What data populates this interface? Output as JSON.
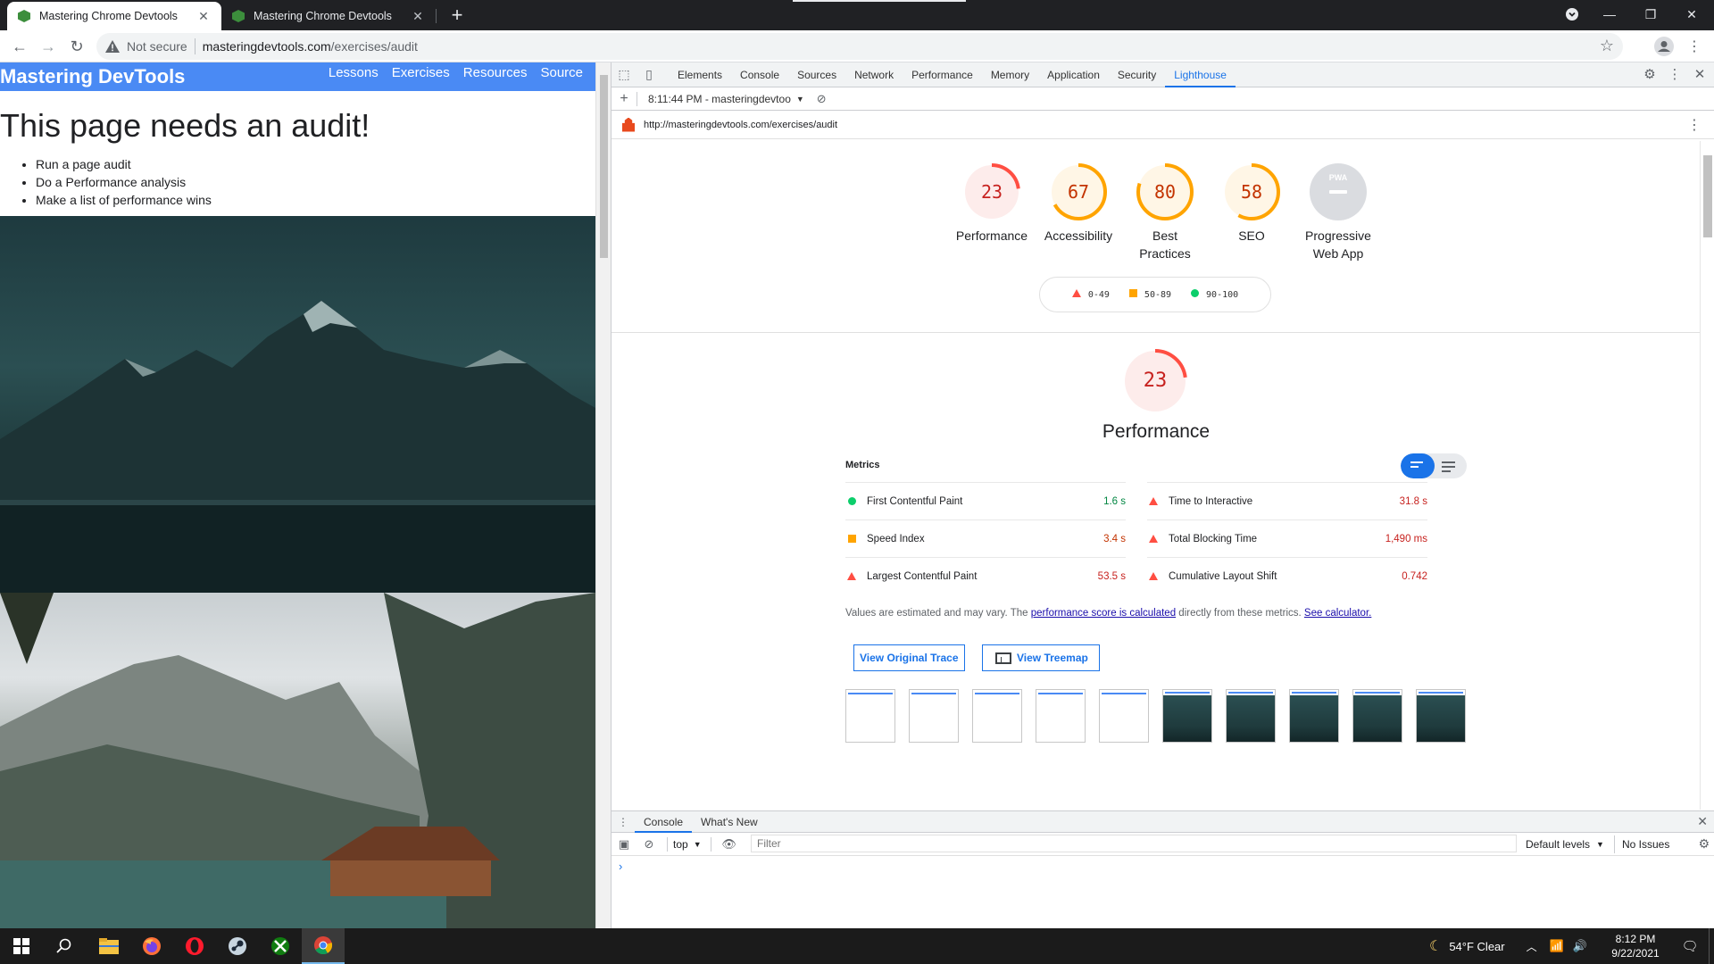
{
  "browser": {
    "tabs": [
      {
        "title": "Mastering Chrome Devtools",
        "active": true
      },
      {
        "title": "Mastering Chrome Devtools",
        "active": false
      }
    ],
    "omnibox": {
      "security": "Not secure",
      "host": "masteringdevtools.com",
      "path": "/exercises/audit"
    }
  },
  "site": {
    "title": "Mastering DevTools",
    "nav": [
      "Lessons",
      "Exercises",
      "Resources",
      "Source"
    ],
    "heading": "This page needs an audit!",
    "list": [
      "Run a page audit",
      "Do a Performance analysis",
      "Make a list of performance wins"
    ]
  },
  "devtools": {
    "tabs": [
      "Elements",
      "Console",
      "Sources",
      "Network",
      "Performance",
      "Memory",
      "Application",
      "Security",
      "Lighthouse"
    ],
    "active_tab": "Lighthouse",
    "report_select": "8:11:44 PM - masteringdevtoo",
    "report_url": "http://masteringdevtools.com/exercises/audit",
    "gauges": [
      {
        "score": "23",
        "label": "Performance",
        "value": 23,
        "color": "#ff4e42",
        "text_color": "#c7221f",
        "bg": "#fdeceb"
      },
      {
        "score": "67",
        "label": "Accessibility",
        "value": 67,
        "color": "#ffa400",
        "text_color": "#c33300",
        "bg": "#fff6e6"
      },
      {
        "score": "80",
        "label": "Best\nPractices",
        "value": 80,
        "color": "#ffa400",
        "text_color": "#c33300",
        "bg": "#fff6e6"
      },
      {
        "score": "58",
        "label": "SEO",
        "value": 58,
        "color": "#ffa400",
        "text_color": "#c33300",
        "bg": "#fff6e6"
      }
    ],
    "pwa": {
      "badge": "PWA",
      "label": "Progressive\nWeb App"
    },
    "legend": [
      "0-49",
      "50-89",
      "90-100"
    ],
    "performance": {
      "score": "23",
      "value": 23,
      "title": "Performance",
      "metrics_label": "Metrics",
      "metrics": [
        {
          "name": "First Contentful Paint",
          "value": "1.6 s",
          "rating": "pass",
          "color": "#018642"
        },
        {
          "name": "Time to Interactive",
          "value": "31.8 s",
          "rating": "fail",
          "color": "#c7221f"
        },
        {
          "name": "Speed Index",
          "value": "3.4 s",
          "rating": "average",
          "color": "#c33300"
        },
        {
          "name": "Total Blocking Time",
          "value": "1,490 ms",
          "rating": "fail",
          "color": "#c7221f"
        },
        {
          "name": "Largest Contentful Paint",
          "value": "53.5 s",
          "rating": "fail",
          "color": "#c7221f"
        },
        {
          "name": "Cumulative Layout Shift",
          "value": "0.742",
          "rating": "fail",
          "color": "#c7221f"
        }
      ],
      "note_pre": "Values are estimated and may vary. The ",
      "note_link1": "performance score is calculated",
      "note_mid": " directly from these metrics. ",
      "note_link2": "See calculator.",
      "btn_trace": "View Original Trace",
      "btn_treemap": "View Treemap"
    },
    "drawer": {
      "tabs": [
        "Console",
        "What's New"
      ],
      "context": "top",
      "filter_placeholder": "Filter",
      "levels": "Default levels",
      "issues": "No Issues",
      "prompt": "›"
    }
  },
  "taskbar": {
    "weather": "54°F  Clear",
    "time": "8:12 PM",
    "date": "9/22/2021"
  }
}
